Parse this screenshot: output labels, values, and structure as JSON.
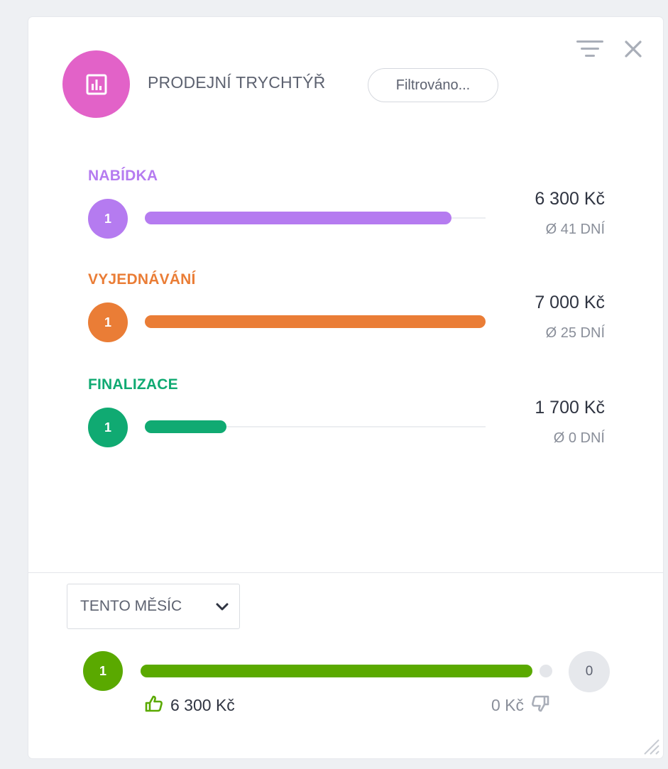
{
  "header": {
    "title": "PRODEJNÍ TRYCHTÝŘ",
    "filter_label": "Filtrováno...",
    "widget_icon": "bar-chart-icon",
    "icon_color": "#e262c8"
  },
  "stages": [
    {
      "label": "NABÍDKA",
      "count": "1",
      "amount": "6 300 Kč",
      "days": "Ø 41 DNÍ",
      "color": "#b57bf0",
      "fill": 0.9
    },
    {
      "label": "VYJEDNÁVÁNÍ",
      "count": "1",
      "amount": "7 000 Kč",
      "days": "Ø 25 DNÍ",
      "color": "#ea7d36",
      "fill": 1.0
    },
    {
      "label": "FINALIZACE",
      "count": "1",
      "amount": "1 700 Kč",
      "days": "Ø 0 DNÍ",
      "color": "#10aa72",
      "fill": 0.24
    }
  ],
  "footer": {
    "period_label": "TENTO MĚSÍC",
    "won_count": "1",
    "lost_count": "0",
    "won_amount": "6 300 Kč",
    "lost_amount": "0 Kč",
    "won_color": "#5aa900"
  }
}
